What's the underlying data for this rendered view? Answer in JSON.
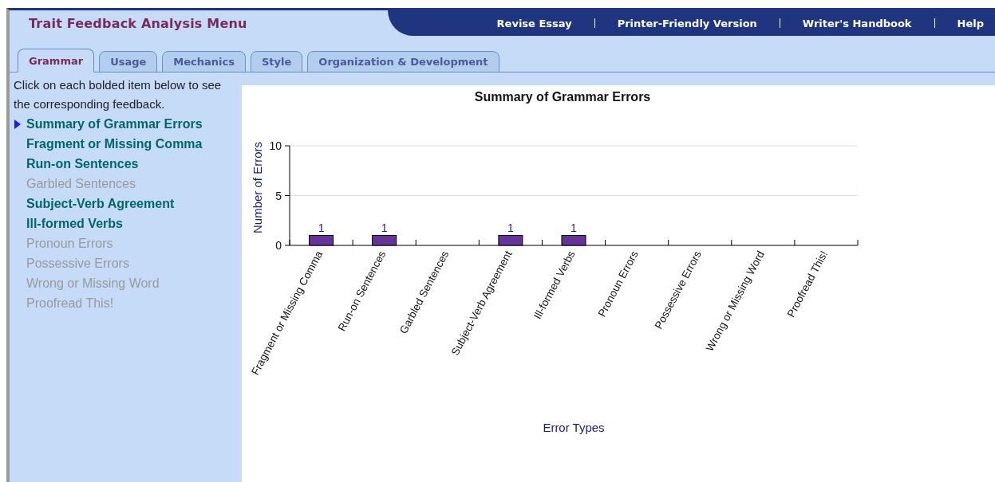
{
  "header": {
    "title": "Trait Feedback Analysis Menu",
    "links": [
      "Revise Essay",
      "Printer-Friendly Version",
      "Writer's Handbook",
      "Help"
    ]
  },
  "tabs": [
    {
      "label": "Grammar",
      "selected": true
    },
    {
      "label": "Usage",
      "selected": false
    },
    {
      "label": "Mechanics",
      "selected": false
    },
    {
      "label": "Style",
      "selected": false
    },
    {
      "label": "Organization & Development",
      "selected": false
    }
  ],
  "sidebar": {
    "instructions": "Click on each bolded item below to see the corresponding feedback.",
    "items": [
      {
        "label": "Summary of Grammar Errors",
        "selected": true,
        "disabled": false
      },
      {
        "label": "Fragment or Missing Comma",
        "selected": false,
        "disabled": false
      },
      {
        "label": "Run-on Sentences",
        "selected": false,
        "disabled": false
      },
      {
        "label": "Garbled Sentences",
        "selected": false,
        "disabled": true
      },
      {
        "label": "Subject-Verb Agreement",
        "selected": false,
        "disabled": false
      },
      {
        "label": "Ill-formed Verbs",
        "selected": false,
        "disabled": false
      },
      {
        "label": "Pronoun Errors",
        "selected": false,
        "disabled": true
      },
      {
        "label": "Possessive Errors",
        "selected": false,
        "disabled": true
      },
      {
        "label": "Wrong or Missing Word",
        "selected": false,
        "disabled": true
      },
      {
        "label": "Proofread This!",
        "selected": false,
        "disabled": true
      }
    ]
  },
  "chart_data": {
    "type": "bar",
    "title": "Summary of Grammar Errors",
    "xlabel": "Error Types",
    "ylabel": "Number of Errors",
    "categories": [
      "Fragment or Missing Comma",
      "Run-on Sentences",
      "Garbled Sentences",
      "Subject-Verb Agreement",
      "Ill-formed Verbs",
      "Pronoun Errors",
      "Possessive Errors",
      "Wrong or Missing Word",
      "Proofread This!"
    ],
    "series": [
      {
        "color": "#663399",
        "values": [
          1,
          1,
          0,
          1,
          1,
          0,
          0,
          0,
          0
        ]
      }
    ],
    "ylim": [
      0,
      10
    ],
    "yticks": [
      0,
      5,
      10
    ],
    "value_labels": [
      "1",
      "1",
      null,
      "1",
      "1",
      null,
      null,
      null,
      null
    ]
  }
}
